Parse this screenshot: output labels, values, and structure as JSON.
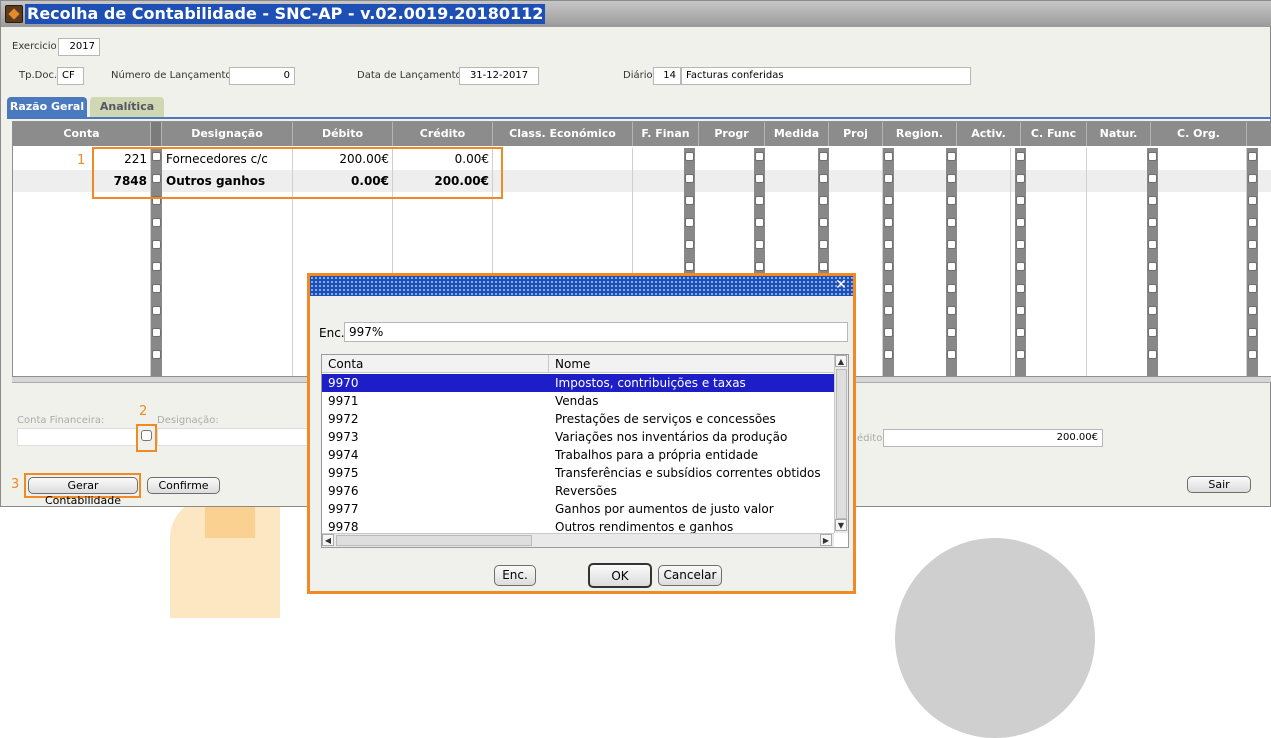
{
  "window": {
    "title": "Recolha de Contabilidade - SNC-AP - v.02.0019.20180112"
  },
  "header": {
    "exercicio_label": "Exercicio",
    "exercicio_value": "2017",
    "tpdoc_label": "Tp.Doc.",
    "tpdoc_value": "CF",
    "numero_label": "Número de Lançamento:",
    "numero_value": "0",
    "data_label": "Data de Lançamento:",
    "data_value": "31-12-2017",
    "diario_label": "Diário:",
    "diario_code": "14",
    "diario_value": "Facturas conferidas"
  },
  "tabs": [
    {
      "label": "Razão Geral",
      "active": true
    },
    {
      "label": "Analítica",
      "active": false
    }
  ],
  "grid": {
    "columns": [
      "Conta",
      "Designação",
      "Débito",
      "Crédito",
      "Class. Económico",
      "F. Finan",
      "Progr",
      "Medida",
      "Proj",
      "Region.",
      "Activ.",
      "C. Func",
      "Natur.",
      "C. Org."
    ],
    "rows": [
      {
        "conta": "221",
        "designacao": "Fornecedores c/c",
        "debito": "200.00€",
        "credito": "0.00€",
        "bold": false
      },
      {
        "conta": "7848",
        "designacao": "Outros ganhos",
        "debito": "0.00€",
        "credito": "200.00€",
        "bold": true
      }
    ]
  },
  "footer": {
    "conta_fin_label": "Conta Financeira:",
    "designacao_label": "Designação:",
    "credito_label": "édito:",
    "credito_value": "200.00€",
    "gerar_label": "Gerar Contabilidade",
    "confirme_label": "Confirme",
    "sair_label": "Sair"
  },
  "annotations": {
    "n1": "1",
    "n2": "2",
    "n3": "3",
    "color": "#f08a24"
  },
  "dialog": {
    "enc_label": "Enc.",
    "enc_value": "997%",
    "col_conta": "Conta",
    "col_nome": "Nome",
    "rows": [
      {
        "conta": "9970",
        "nome": "Impostos, contribuições e taxas",
        "selected": true
      },
      {
        "conta": "9971",
        "nome": "Vendas",
        "selected": false
      },
      {
        "conta": "9972",
        "nome": "Prestações de serviços e concessões",
        "selected": false
      },
      {
        "conta": "9973",
        "nome": "Variações nos inventários da produção",
        "selected": false
      },
      {
        "conta": "9974",
        "nome": "Trabalhos para a própria entidade",
        "selected": false
      },
      {
        "conta": "9975",
        "nome": "Transferências e subsídios correntes obtidos",
        "selected": false
      },
      {
        "conta": "9976",
        "nome": "Reversões",
        "selected": false
      },
      {
        "conta": "9977",
        "nome": "Ganhos por aumentos de justo valor",
        "selected": false
      },
      {
        "conta": "9978",
        "nome": "Outros rendimentos e ganhos",
        "selected": false
      }
    ],
    "btn_enc": "Enc.",
    "btn_ok": "OK",
    "btn_cancel": "Cancelar"
  }
}
